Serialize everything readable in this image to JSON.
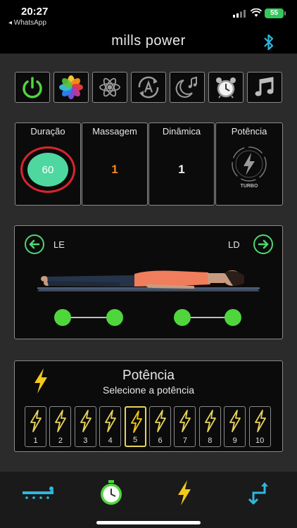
{
  "status": {
    "time": "20:27",
    "back_app": "◂ WhatsApp",
    "battery": "55"
  },
  "header": {
    "title": "mills power"
  },
  "modes": [
    {
      "icon": "power-icon",
      "name": "mode-power-button"
    },
    {
      "icon": "photos-icon",
      "name": "mode-color-button"
    },
    {
      "icon": "atom-icon",
      "name": "mode-atom-button"
    },
    {
      "icon": "auto-refresh-icon",
      "name": "mode-auto-button"
    },
    {
      "icon": "moon-music-icon",
      "name": "mode-sleep-button"
    },
    {
      "icon": "alarm-clock-icon",
      "name": "mode-alarm-button"
    },
    {
      "icon": "music-note-icon",
      "name": "mode-music-button"
    }
  ],
  "stats": {
    "duracao": {
      "label": "Duração",
      "value": "60"
    },
    "massagem": {
      "label": "Massagem",
      "value": "1"
    },
    "dinamica": {
      "label": "Dinâmica",
      "value": "1"
    },
    "potencia": {
      "label": "Potência",
      "badge": "TURBO"
    }
  },
  "body_panel": {
    "left_label": "LE",
    "right_label": "LD"
  },
  "power_panel": {
    "title": "Potência",
    "subtitle": "Selecione a potência",
    "levels": [
      "1",
      "2",
      "3",
      "4",
      "5",
      "6",
      "7",
      "8",
      "9",
      "10"
    ],
    "selected_level": "5"
  },
  "tabs": [
    {
      "icon": "massage-table-icon",
      "name": "tab-massage"
    },
    {
      "icon": "stopwatch-icon",
      "name": "tab-timer"
    },
    {
      "icon": "lightning-icon",
      "name": "tab-power"
    },
    {
      "icon": "swap-arrows-icon",
      "name": "tab-switch"
    }
  ],
  "colors": {
    "green": "#4fd63d",
    "yellow": "#e6d35a",
    "orange": "#f08a1c",
    "red": "#d9252b",
    "cyan": "#2cb8e0",
    "timer_fill": "#4ed8a0"
  }
}
